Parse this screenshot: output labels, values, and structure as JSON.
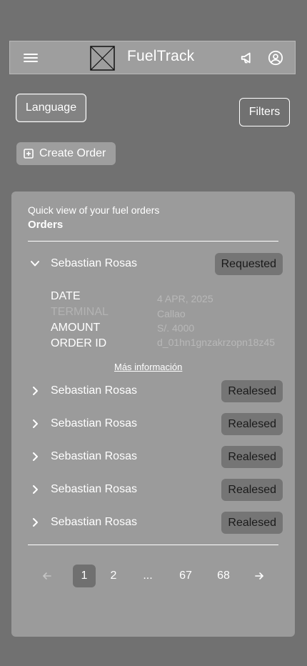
{
  "header": {
    "brand": "FuelTrack",
    "menu_icon": "hamburger-menu-icon",
    "logo_icon": "placeholder-logo-icon",
    "notify_icon": "megaphone-icon",
    "profile_icon": "user-circle-icon"
  },
  "toolbar": {
    "language_label": "Language",
    "filters_label": "Filters",
    "create_order_label": "Create Order"
  },
  "orders_card": {
    "subtitle": "Quick view of your fuel orders",
    "title": "Orders",
    "expanded_order": {
      "name": "Sebastian Rosas",
      "status": "Requested",
      "details": {
        "date_label": "DATE",
        "date_value": "4 APR, 2025",
        "terminal_label": "TERMINAL",
        "terminal_value": "Callao",
        "amount_label": "AMOUNT",
        "amount_value": "S/. 4000",
        "order_id_label": "ORDER ID",
        "order_id_value": "d_01hn1gnzakrzopn18z45"
      },
      "more_info_label": "Más información"
    },
    "orders": [
      {
        "name": "Sebastian Rosas",
        "status": "Realesed"
      },
      {
        "name": "Sebastian Rosas",
        "status": "Realesed"
      },
      {
        "name": "Sebastian Rosas",
        "status": "Realesed"
      },
      {
        "name": "Sebastian Rosas",
        "status": "Realesed"
      },
      {
        "name": "Sebastian Rosas",
        "status": "Realesed"
      }
    ]
  },
  "pagination": {
    "prev_icon": "arrow-left-icon",
    "next_icon": "arrow-right-icon",
    "pages": [
      "1",
      "2",
      "...",
      "67",
      "68"
    ],
    "current_page": "1"
  },
  "colors": {
    "background": "#717171",
    "card": "#9b9b9b",
    "badge": "#757575"
  }
}
